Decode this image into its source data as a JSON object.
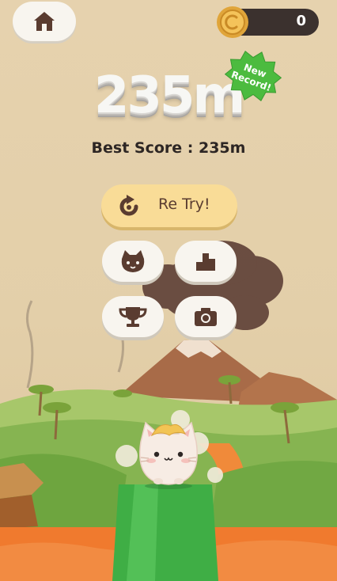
{
  "hud": {
    "coin_count": "0"
  },
  "result": {
    "distance": "235m",
    "new_record_line1": "New",
    "new_record_line2": "Record!",
    "best_score": "Best Score : 235m"
  },
  "buttons": {
    "retry_label": "Re Try!"
  },
  "colors": {
    "accent_yellow": "#f9dc97",
    "icon_brown": "#5a3c30",
    "record_badge_green": "#4cbb3f",
    "lava": "#f07a2e",
    "pillar_green": "#3fae45"
  },
  "icons": [
    "home-icon",
    "coin-icon",
    "retry-icon",
    "character-icon",
    "leaderboard-icon",
    "trophy-icon",
    "camera-icon"
  ]
}
